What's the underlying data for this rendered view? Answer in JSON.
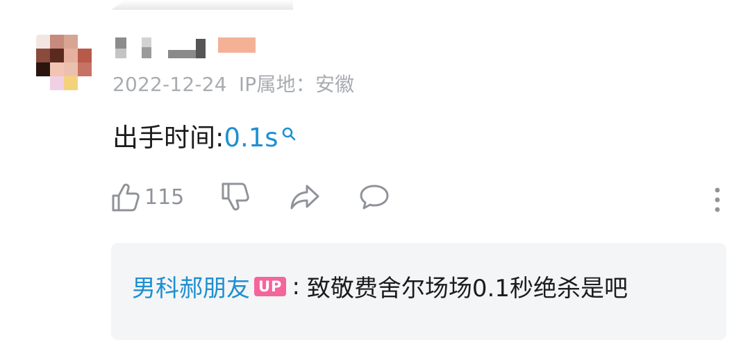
{
  "comment": {
    "date": "2022-12-24",
    "ip_location": "IP属地：安徽",
    "text_prefix": "出手时间:",
    "text_link": "0.1s",
    "like_count": "115"
  },
  "reply": {
    "author": "男科郝朋友",
    "badge": "UP",
    "separator": ":",
    "text": "致敬费舍尔场场0.1秒绝杀是吧"
  },
  "icons": {
    "search": "search-icon",
    "like": "thumbs-up-icon",
    "dislike": "thumbs-down-icon",
    "share": "share-icon",
    "reply": "comment-icon",
    "more": "more-vertical-icon"
  },
  "colors": {
    "link": "#1e8fd1",
    "up_badge": "#f4659b",
    "meta_text": "#a8abb0",
    "reply_bg": "#f4f5f7"
  }
}
